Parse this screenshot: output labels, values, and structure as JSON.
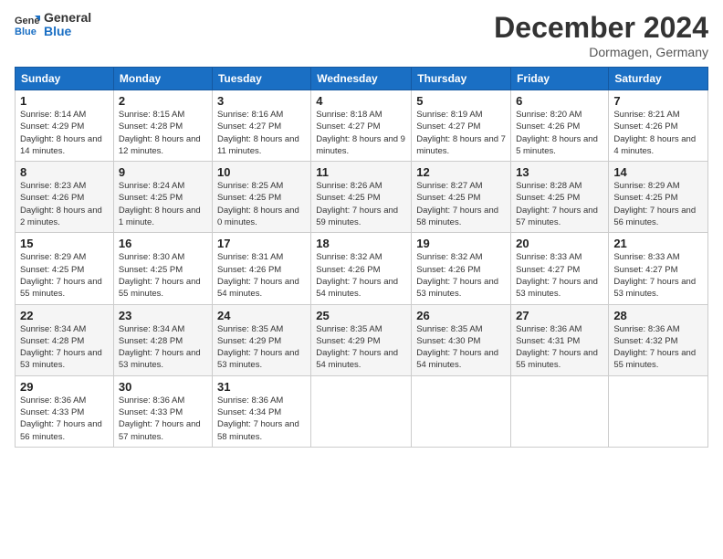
{
  "logo": {
    "line1": "General",
    "line2": "Blue"
  },
  "title": "December 2024",
  "subtitle": "Dormagen, Germany",
  "weekdays": [
    "Sunday",
    "Monday",
    "Tuesday",
    "Wednesday",
    "Thursday",
    "Friday",
    "Saturday"
  ],
  "weeks": [
    [
      {
        "day": "1",
        "sunrise": "Sunrise: 8:14 AM",
        "sunset": "Sunset: 4:29 PM",
        "daylight": "Daylight: 8 hours and 14 minutes."
      },
      {
        "day": "2",
        "sunrise": "Sunrise: 8:15 AM",
        "sunset": "Sunset: 4:28 PM",
        "daylight": "Daylight: 8 hours and 12 minutes."
      },
      {
        "day": "3",
        "sunrise": "Sunrise: 8:16 AM",
        "sunset": "Sunset: 4:27 PM",
        "daylight": "Daylight: 8 hours and 11 minutes."
      },
      {
        "day": "4",
        "sunrise": "Sunrise: 8:18 AM",
        "sunset": "Sunset: 4:27 PM",
        "daylight": "Daylight: 8 hours and 9 minutes."
      },
      {
        "day": "5",
        "sunrise": "Sunrise: 8:19 AM",
        "sunset": "Sunset: 4:27 PM",
        "daylight": "Daylight: 8 hours and 7 minutes."
      },
      {
        "day": "6",
        "sunrise": "Sunrise: 8:20 AM",
        "sunset": "Sunset: 4:26 PM",
        "daylight": "Daylight: 8 hours and 5 minutes."
      },
      {
        "day": "7",
        "sunrise": "Sunrise: 8:21 AM",
        "sunset": "Sunset: 4:26 PM",
        "daylight": "Daylight: 8 hours and 4 minutes."
      }
    ],
    [
      {
        "day": "8",
        "sunrise": "Sunrise: 8:23 AM",
        "sunset": "Sunset: 4:26 PM",
        "daylight": "Daylight: 8 hours and 2 minutes."
      },
      {
        "day": "9",
        "sunrise": "Sunrise: 8:24 AM",
        "sunset": "Sunset: 4:25 PM",
        "daylight": "Daylight: 8 hours and 1 minute."
      },
      {
        "day": "10",
        "sunrise": "Sunrise: 8:25 AM",
        "sunset": "Sunset: 4:25 PM",
        "daylight": "Daylight: 8 hours and 0 minutes."
      },
      {
        "day": "11",
        "sunrise": "Sunrise: 8:26 AM",
        "sunset": "Sunset: 4:25 PM",
        "daylight": "Daylight: 7 hours and 59 minutes."
      },
      {
        "day": "12",
        "sunrise": "Sunrise: 8:27 AM",
        "sunset": "Sunset: 4:25 PM",
        "daylight": "Daylight: 7 hours and 58 minutes."
      },
      {
        "day": "13",
        "sunrise": "Sunrise: 8:28 AM",
        "sunset": "Sunset: 4:25 PM",
        "daylight": "Daylight: 7 hours and 57 minutes."
      },
      {
        "day": "14",
        "sunrise": "Sunrise: 8:29 AM",
        "sunset": "Sunset: 4:25 PM",
        "daylight": "Daylight: 7 hours and 56 minutes."
      }
    ],
    [
      {
        "day": "15",
        "sunrise": "Sunrise: 8:29 AM",
        "sunset": "Sunset: 4:25 PM",
        "daylight": "Daylight: 7 hours and 55 minutes."
      },
      {
        "day": "16",
        "sunrise": "Sunrise: 8:30 AM",
        "sunset": "Sunset: 4:25 PM",
        "daylight": "Daylight: 7 hours and 55 minutes."
      },
      {
        "day": "17",
        "sunrise": "Sunrise: 8:31 AM",
        "sunset": "Sunset: 4:26 PM",
        "daylight": "Daylight: 7 hours and 54 minutes."
      },
      {
        "day": "18",
        "sunrise": "Sunrise: 8:32 AM",
        "sunset": "Sunset: 4:26 PM",
        "daylight": "Daylight: 7 hours and 54 minutes."
      },
      {
        "day": "19",
        "sunrise": "Sunrise: 8:32 AM",
        "sunset": "Sunset: 4:26 PM",
        "daylight": "Daylight: 7 hours and 53 minutes."
      },
      {
        "day": "20",
        "sunrise": "Sunrise: 8:33 AM",
        "sunset": "Sunset: 4:27 PM",
        "daylight": "Daylight: 7 hours and 53 minutes."
      },
      {
        "day": "21",
        "sunrise": "Sunrise: 8:33 AM",
        "sunset": "Sunset: 4:27 PM",
        "daylight": "Daylight: 7 hours and 53 minutes."
      }
    ],
    [
      {
        "day": "22",
        "sunrise": "Sunrise: 8:34 AM",
        "sunset": "Sunset: 4:28 PM",
        "daylight": "Daylight: 7 hours and 53 minutes."
      },
      {
        "day": "23",
        "sunrise": "Sunrise: 8:34 AM",
        "sunset": "Sunset: 4:28 PM",
        "daylight": "Daylight: 7 hours and 53 minutes."
      },
      {
        "day": "24",
        "sunrise": "Sunrise: 8:35 AM",
        "sunset": "Sunset: 4:29 PM",
        "daylight": "Daylight: 7 hours and 53 minutes."
      },
      {
        "day": "25",
        "sunrise": "Sunrise: 8:35 AM",
        "sunset": "Sunset: 4:29 PM",
        "daylight": "Daylight: 7 hours and 54 minutes."
      },
      {
        "day": "26",
        "sunrise": "Sunrise: 8:35 AM",
        "sunset": "Sunset: 4:30 PM",
        "daylight": "Daylight: 7 hours and 54 minutes."
      },
      {
        "day": "27",
        "sunrise": "Sunrise: 8:36 AM",
        "sunset": "Sunset: 4:31 PM",
        "daylight": "Daylight: 7 hours and 55 minutes."
      },
      {
        "day": "28",
        "sunrise": "Sunrise: 8:36 AM",
        "sunset": "Sunset: 4:32 PM",
        "daylight": "Daylight: 7 hours and 55 minutes."
      }
    ],
    [
      {
        "day": "29",
        "sunrise": "Sunrise: 8:36 AM",
        "sunset": "Sunset: 4:33 PM",
        "daylight": "Daylight: 7 hours and 56 minutes."
      },
      {
        "day": "30",
        "sunrise": "Sunrise: 8:36 AM",
        "sunset": "Sunset: 4:33 PM",
        "daylight": "Daylight: 7 hours and 57 minutes."
      },
      {
        "day": "31",
        "sunrise": "Sunrise: 8:36 AM",
        "sunset": "Sunset: 4:34 PM",
        "daylight": "Daylight: 7 hours and 58 minutes."
      },
      null,
      null,
      null,
      null
    ]
  ]
}
